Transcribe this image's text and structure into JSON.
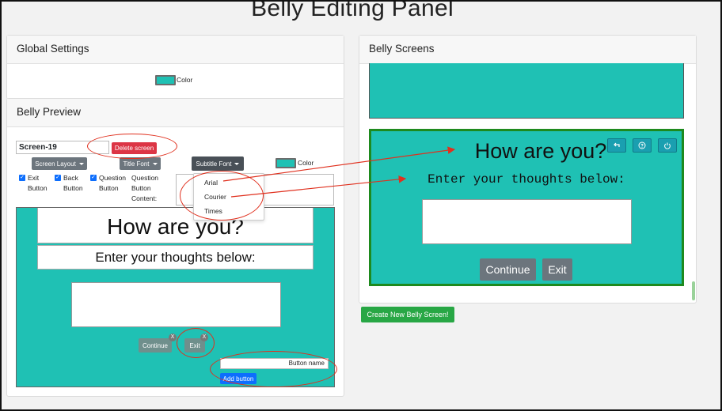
{
  "page": {
    "title": "Belly Editing Panel"
  },
  "global_settings": {
    "header": "Global Settings",
    "color_label": "Color"
  },
  "preview": {
    "header": "Belly Preview",
    "screen_name_value": "Screen-19",
    "delete_label": "Delete screen",
    "screen_layout_label": "Screen Layout",
    "title_font_label": "Title Font",
    "subtitle_font_label": "Subtitle Font",
    "color_label": "Color",
    "checkboxes": [
      {
        "line1": "Exit",
        "line2": "Button"
      },
      {
        "line1": "Back",
        "line2": "Button"
      },
      {
        "line1": "Question",
        "line2": "Button"
      }
    ],
    "question_content_label": [
      "Question",
      "Button",
      "Content:"
    ],
    "font_options": [
      "Arial",
      "Courier",
      "Times"
    ],
    "title_text": "How are you?",
    "subtitle_text": "Enter your thoughts below:",
    "continue_label": "Continue",
    "exit_label": "Exit",
    "x_label": "X",
    "button_name_placeholder": "Button name",
    "add_button_label": "Add button"
  },
  "screens": {
    "header": "Belly Screens",
    "title_text": "How are you?",
    "subtitle_text": "Enter your thoughts below:",
    "continue_label": "Continue",
    "exit_label": "Exit",
    "create_label": "Create New Belly Screen!"
  },
  "colors": {
    "teal": "#1fc1b4",
    "screen_border": "#1e8a1e",
    "annotation": "#e0301e"
  }
}
